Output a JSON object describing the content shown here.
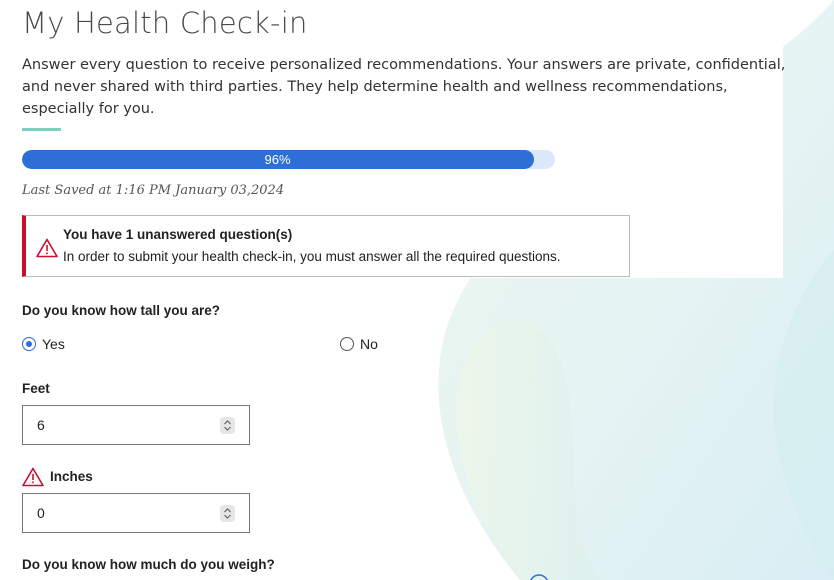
{
  "page": {
    "title": "My Health Check-in",
    "intro": "Answer every question to receive personalized recommendations. Your answers are private, confidential, and never shared with third parties. They help determine health and wellness recommendations, especially for you."
  },
  "progress": {
    "value": 0.96,
    "label": "96%"
  },
  "last_saved": "Last Saved at 1:16 PM January 03,2024",
  "alert": {
    "icon": "warning-icon",
    "title": "You have 1 unanswered question(s)",
    "message": "In order to submit your health check-in, you must answer all the required questions."
  },
  "question_height": {
    "label": "Do you know how tall you are?",
    "options": [
      {
        "label": "Yes",
        "selected": true
      },
      {
        "label": "No",
        "selected": false
      }
    ]
  },
  "feet": {
    "label": "Feet",
    "value": "6"
  },
  "inches": {
    "label": "Inches",
    "value": "0",
    "warning_icon": "warning-icon"
  },
  "question_weight": {
    "label": "Do you know how much do you weigh?"
  },
  "colors": {
    "primary": "#2d6fd6",
    "progress_track": "#dbe8fb",
    "accent": "#7fcfbf",
    "alert": "#c8102e"
  }
}
